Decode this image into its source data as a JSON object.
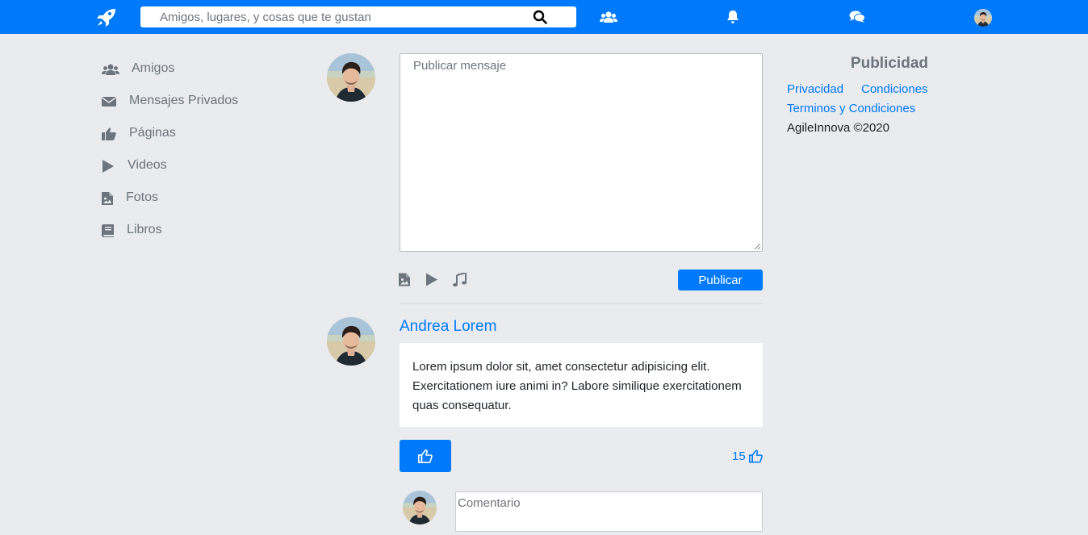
{
  "header": {
    "search_placeholder": "Amigos, lugares, y cosas que te gustan",
    "icons": [
      "rocket-icon",
      "search-icon",
      "users-icon",
      "bell-icon",
      "comments-icon",
      "avatar"
    ]
  },
  "sidebar": {
    "items": [
      {
        "label": "Amigos",
        "icon": "users-icon"
      },
      {
        "label": "Mensajes Privados",
        "icon": "envelope-icon"
      },
      {
        "label": "Páginas",
        "icon": "thumbs-up-icon"
      },
      {
        "label": "Videos",
        "icon": "play-icon"
      },
      {
        "label": "Fotos",
        "icon": "image-file-icon"
      },
      {
        "label": "Libros",
        "icon": "book-icon"
      }
    ]
  },
  "composer": {
    "placeholder": "Publicar mensaje",
    "tools": [
      "image-file-icon",
      "play-icon",
      "music-icon"
    ],
    "publish_label": "Publicar"
  },
  "post": {
    "author": "Andrea Lorem",
    "text": "Lorem ipsum dolor sit, amet consectetur adipisicing elit. Exercitationem iure animi in? Labore similique exercitationem quas consequatur.",
    "likes": "15",
    "comment_placeholder": "Comentario"
  },
  "aside": {
    "title": "Publicidad",
    "links": [
      "Privacidad",
      "Condiciones",
      "Terminos y Condiciones"
    ],
    "copyright": "AgileInnova ©2020"
  },
  "colors": {
    "primary": "#0079fa",
    "background": "#e9ebee",
    "muted": "#6c757d"
  }
}
